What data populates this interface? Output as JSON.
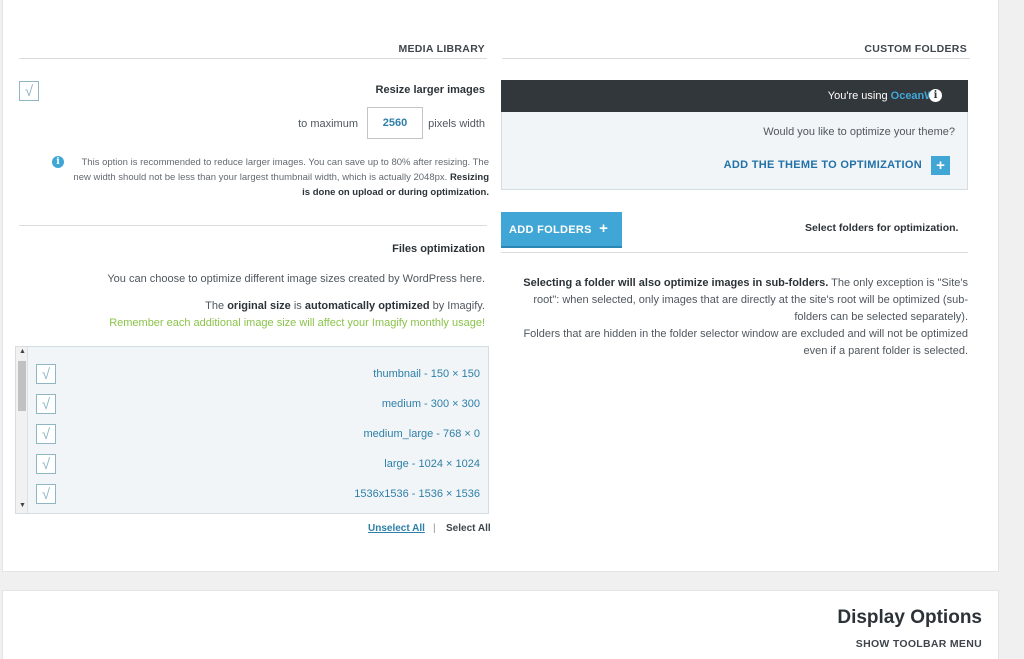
{
  "media_library": {
    "title": "MEDIA LIBRARY",
    "resize_label": "Resize larger images",
    "to_maximum": "to maximum",
    "max_width": "2560",
    "pixels_width": "pixels width",
    "help_text": "This option is recommended to reduce larger images. You can save up to 80% after resizing. The new width should not be less than your largest thumbnail width, which is actually 2048px.",
    "help_bold": "Resizing is done on upload or during optimization.",
    "files_optimization": "Files optimization",
    "choose_sizes": "You can choose to optimize different image sizes created by WordPress here.",
    "original_pre": "The",
    "original_bold1": "original size",
    "original_mid": "is",
    "original_bold2": "automatically optimized",
    "original_post": "by Imagify.",
    "remember": "Remember each additional image size will affect your Imagify monthly usage!",
    "sizes": [
      {
        "label": "thumbnail - 150 × 150",
        "checked": true
      },
      {
        "label": "medium - 300 × 300",
        "checked": true
      },
      {
        "label": "medium_large - 768 × 0",
        "checked": true
      },
      {
        "label": "large - 1024 × 1024",
        "checked": true
      },
      {
        "label": "1536x1536 - 1536 × 1536",
        "checked": true
      }
    ],
    "unselect_all": "Unselect All",
    "separator": "|",
    "select_all": "Select All"
  },
  "custom_folders": {
    "title": "CUSTOM FOLDERS",
    "using_prefix": "You're using",
    "theme_name": "OceanWP",
    "question": "Would you like to optimize your theme?",
    "add_theme": "ADD THE THEME TO OPTIMIZATION",
    "add_folders": "ADD FOLDERS",
    "select_folders": "Select folders for optimization.",
    "para_bold": "Selecting a folder will also optimize images in sub-folders.",
    "para_rest": "The only exception is \"Site's root\": when selected, only images that are directly at the site's root will be optimized (sub-folders can be selected separately).",
    "para2": "Folders that are hidden in the folder selector window are excluded and will not be optimized even if a parent folder is selected."
  },
  "display_options": {
    "title": "Display Options",
    "toolbar": "SHOW TOOLBAR MENU"
  },
  "colors": {
    "accent": "#40a6d6",
    "dark_bar": "#32373c",
    "green": "#8bc34a"
  }
}
